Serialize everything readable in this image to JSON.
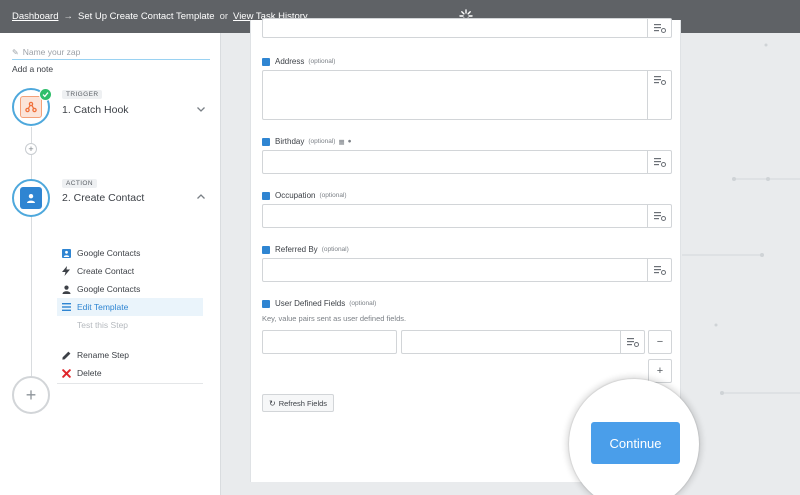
{
  "topbar": {
    "dashboard": "Dashboard",
    "arrow": "→",
    "current": "Set Up Create Contact Template",
    "or": "or",
    "history": "View Task History"
  },
  "sidebar": {
    "zap_placeholder": "Name your zap",
    "add_note": "Add a note",
    "trigger": {
      "tag": "TRIGGER",
      "title": "1. Catch Hook"
    },
    "action": {
      "tag": "ACTION",
      "title": "2. Create Contact"
    },
    "substeps": [
      {
        "label": "Google Contacts"
      },
      {
        "label": "Create Contact"
      },
      {
        "label": "Google Contacts"
      },
      {
        "label": "Edit Template"
      },
      {
        "label": "Test this Step"
      }
    ],
    "rename": "Rename Step",
    "delete": "Delete"
  },
  "form": {
    "address": {
      "label": "Address",
      "opt": "(optional)"
    },
    "birthday": {
      "label": "Birthday",
      "opt": "(optional)"
    },
    "occupation": {
      "label": "Occupation",
      "opt": "(optional)"
    },
    "referred": {
      "label": "Referred By",
      "opt": "(optional)"
    },
    "udf": {
      "label": "User Defined Fields",
      "opt": "(optional)",
      "help": "Key, value pairs sent as user defined fields."
    },
    "minus": "−",
    "plus": "+",
    "refresh": "Refresh Fields",
    "continue": "Continue"
  },
  "colors": {
    "topbar": "#5f6266",
    "accent": "#2f85d2",
    "button": "#4a9eea",
    "success": "#2fbe6a",
    "danger": "#e0262b"
  }
}
